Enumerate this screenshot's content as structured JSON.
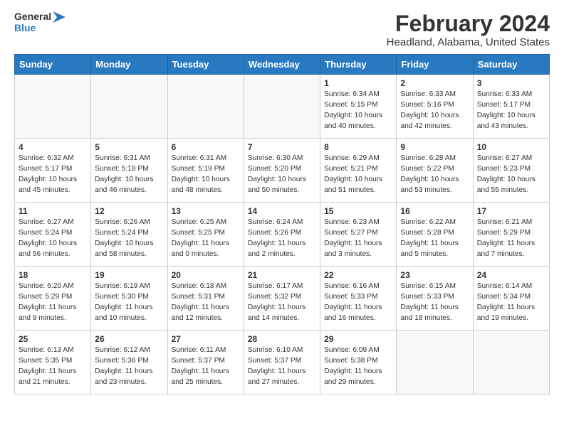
{
  "logo": {
    "line1": "General",
    "line2": "Blue"
  },
  "title": {
    "month_year": "February 2024",
    "location": "Headland, Alabama, United States"
  },
  "weekdays": [
    "Sunday",
    "Monday",
    "Tuesday",
    "Wednesday",
    "Thursday",
    "Friday",
    "Saturday"
  ],
  "weeks": [
    [
      {
        "day": "",
        "info": ""
      },
      {
        "day": "",
        "info": ""
      },
      {
        "day": "",
        "info": ""
      },
      {
        "day": "",
        "info": ""
      },
      {
        "day": "1",
        "info": "Sunrise: 6:34 AM\nSunset: 5:15 PM\nDaylight: 10 hours\nand 40 minutes."
      },
      {
        "day": "2",
        "info": "Sunrise: 6:33 AM\nSunset: 5:16 PM\nDaylight: 10 hours\nand 42 minutes."
      },
      {
        "day": "3",
        "info": "Sunrise: 6:33 AM\nSunset: 5:17 PM\nDaylight: 10 hours\nand 43 minutes."
      }
    ],
    [
      {
        "day": "4",
        "info": "Sunrise: 6:32 AM\nSunset: 5:17 PM\nDaylight: 10 hours\nand 45 minutes."
      },
      {
        "day": "5",
        "info": "Sunrise: 6:31 AM\nSunset: 5:18 PM\nDaylight: 10 hours\nand 46 minutes."
      },
      {
        "day": "6",
        "info": "Sunrise: 6:31 AM\nSunset: 5:19 PM\nDaylight: 10 hours\nand 48 minutes."
      },
      {
        "day": "7",
        "info": "Sunrise: 6:30 AM\nSunset: 5:20 PM\nDaylight: 10 hours\nand 50 minutes."
      },
      {
        "day": "8",
        "info": "Sunrise: 6:29 AM\nSunset: 5:21 PM\nDaylight: 10 hours\nand 51 minutes."
      },
      {
        "day": "9",
        "info": "Sunrise: 6:28 AM\nSunset: 5:22 PM\nDaylight: 10 hours\nand 53 minutes."
      },
      {
        "day": "10",
        "info": "Sunrise: 6:27 AM\nSunset: 5:23 PM\nDaylight: 10 hours\nand 55 minutes."
      }
    ],
    [
      {
        "day": "11",
        "info": "Sunrise: 6:27 AM\nSunset: 5:24 PM\nDaylight: 10 hours\nand 56 minutes."
      },
      {
        "day": "12",
        "info": "Sunrise: 6:26 AM\nSunset: 5:24 PM\nDaylight: 10 hours\nand 58 minutes."
      },
      {
        "day": "13",
        "info": "Sunrise: 6:25 AM\nSunset: 5:25 PM\nDaylight: 11 hours\nand 0 minutes."
      },
      {
        "day": "14",
        "info": "Sunrise: 6:24 AM\nSunset: 5:26 PM\nDaylight: 11 hours\nand 2 minutes."
      },
      {
        "day": "15",
        "info": "Sunrise: 6:23 AM\nSunset: 5:27 PM\nDaylight: 11 hours\nand 3 minutes."
      },
      {
        "day": "16",
        "info": "Sunrise: 6:22 AM\nSunset: 5:28 PM\nDaylight: 11 hours\nand 5 minutes."
      },
      {
        "day": "17",
        "info": "Sunrise: 6:21 AM\nSunset: 5:29 PM\nDaylight: 11 hours\nand 7 minutes."
      }
    ],
    [
      {
        "day": "18",
        "info": "Sunrise: 6:20 AM\nSunset: 5:29 PM\nDaylight: 11 hours\nand 9 minutes."
      },
      {
        "day": "19",
        "info": "Sunrise: 6:19 AM\nSunset: 5:30 PM\nDaylight: 11 hours\nand 10 minutes."
      },
      {
        "day": "20",
        "info": "Sunrise: 6:18 AM\nSunset: 5:31 PM\nDaylight: 11 hours\nand 12 minutes."
      },
      {
        "day": "21",
        "info": "Sunrise: 6:17 AM\nSunset: 5:32 PM\nDaylight: 11 hours\nand 14 minutes."
      },
      {
        "day": "22",
        "info": "Sunrise: 6:16 AM\nSunset: 5:33 PM\nDaylight: 11 hours\nand 16 minutes."
      },
      {
        "day": "23",
        "info": "Sunrise: 6:15 AM\nSunset: 5:33 PM\nDaylight: 11 hours\nand 18 minutes."
      },
      {
        "day": "24",
        "info": "Sunrise: 6:14 AM\nSunset: 5:34 PM\nDaylight: 11 hours\nand 19 minutes."
      }
    ],
    [
      {
        "day": "25",
        "info": "Sunrise: 6:13 AM\nSunset: 5:35 PM\nDaylight: 11 hours\nand 21 minutes."
      },
      {
        "day": "26",
        "info": "Sunrise: 6:12 AM\nSunset: 5:36 PM\nDaylight: 11 hours\nand 23 minutes."
      },
      {
        "day": "27",
        "info": "Sunrise: 6:11 AM\nSunset: 5:37 PM\nDaylight: 11 hours\nand 25 minutes."
      },
      {
        "day": "28",
        "info": "Sunrise: 6:10 AM\nSunset: 5:37 PM\nDaylight: 11 hours\nand 27 minutes."
      },
      {
        "day": "29",
        "info": "Sunrise: 6:09 AM\nSunset: 5:38 PM\nDaylight: 11 hours\nand 29 minutes."
      },
      {
        "day": "",
        "info": ""
      },
      {
        "day": "",
        "info": ""
      }
    ]
  ]
}
